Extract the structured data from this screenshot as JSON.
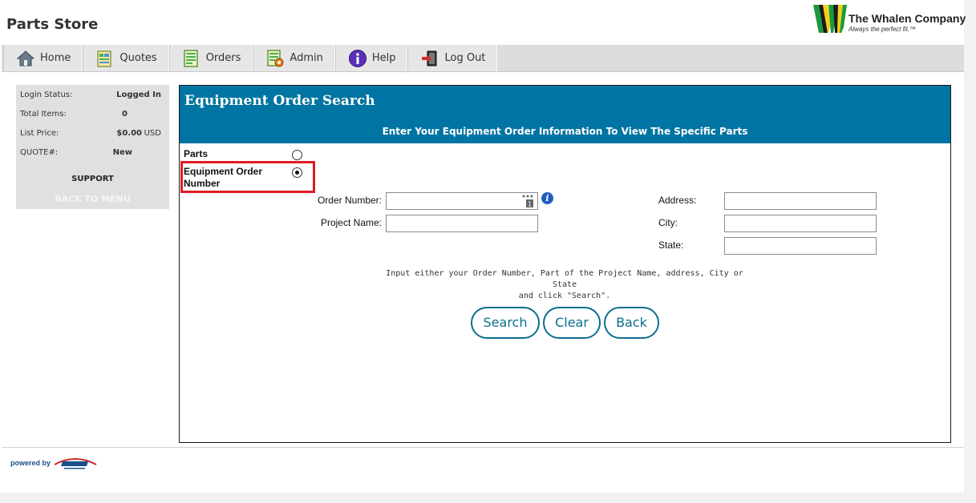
{
  "app": {
    "title": "Parts Store"
  },
  "brand": {
    "name": "The Whalen Company",
    "tagline": "Always the perfect fit.™",
    "colors": {
      "green": "#1a9a3c",
      "yellow": "#f2d019",
      "dark": "#1b1b1b"
    }
  },
  "nav": {
    "items": [
      {
        "label": "Home",
        "icon": "home-icon"
      },
      {
        "label": "Quotes",
        "icon": "quotes-icon"
      },
      {
        "label": "Orders",
        "icon": "orders-icon"
      },
      {
        "label": "Admin",
        "icon": "admin-icon"
      },
      {
        "label": "Help",
        "icon": "help-icon"
      },
      {
        "label": "Log Out",
        "icon": "logout-icon"
      }
    ]
  },
  "sidebar": {
    "rows": [
      {
        "label": "Login Status:",
        "value": "Logged In"
      },
      {
        "label": "Total Items:",
        "value": "0"
      },
      {
        "label": "List Price:",
        "value": "$0.00",
        "unit": "USD"
      },
      {
        "label": "QUOTE#:",
        "value": "New"
      }
    ],
    "support": "SUPPORT",
    "back_to_menu": "BACK TO MENU"
  },
  "panel": {
    "title": "Equipment Order Search",
    "subtitle": "Enter Your Equipment Order Information To View The Specific Parts",
    "options": [
      {
        "label": "Parts",
        "selected": false
      },
      {
        "label": "Equipment Order Number",
        "line1": "Equipment Order",
        "line2": "Number",
        "selected": true
      }
    ],
    "fields": {
      "order_number": {
        "label": "Order Number:",
        "value": ""
      },
      "project_name": {
        "label": "Project Name:",
        "value": ""
      },
      "address": {
        "label": "Address:",
        "value": ""
      },
      "city": {
        "label": "City:",
        "value": ""
      },
      "state": {
        "label": "State:",
        "value": ""
      }
    },
    "hint_line1": "Input either your Order Number, Part of the Project Name, address, City or State",
    "hint_line2": "and click \"Search\".",
    "buttons": {
      "search": "Search",
      "clear": "Clear",
      "back": "Back"
    },
    "accent_color": "#0074a2"
  },
  "footer": {
    "powered_by": "powered by"
  }
}
